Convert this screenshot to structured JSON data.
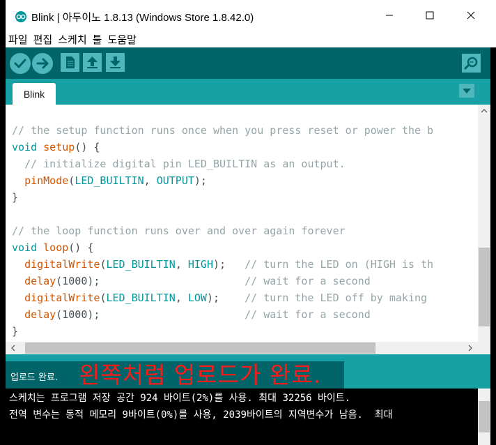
{
  "window": {
    "title": "Blink | 아두이노 1.8.13 (Windows Store 1.8.42.0)"
  },
  "menubar": {
    "items": [
      "파일",
      "편집",
      "스케치",
      "툴",
      "도움말"
    ]
  },
  "toolbar": {
    "buttons": [
      {
        "name": "verify",
        "icon": "check-icon"
      },
      {
        "name": "upload",
        "icon": "arrow-right-icon"
      },
      {
        "name": "new",
        "icon": "document-icon"
      },
      {
        "name": "open",
        "icon": "arrow-up-icon"
      },
      {
        "name": "save",
        "icon": "arrow-down-icon"
      },
      {
        "name": "serial-monitor",
        "icon": "magnifier-icon"
      }
    ]
  },
  "tabs": {
    "active": "Blink"
  },
  "editor": {
    "lines": [
      "// the setup function runs once when you press reset or power the b",
      "void setup() {",
      "  // initialize digital pin LED_BUILTIN as an output.",
      "  pinMode(LED_BUILTIN, OUTPUT);",
      "}",
      "",
      "// the loop function runs over and over again forever",
      "void loop() {",
      "  digitalWrite(LED_BUILTIN, HIGH);   // turn the LED on (HIGH is th",
      "  delay(1000);                       // wait for a second",
      "  digitalWrite(LED_BUILTIN, LOW);    // turn the LED off by making",
      "  delay(1000);                       // wait for a second",
      "}"
    ]
  },
  "status": {
    "message": "업로드 완료.",
    "overlay_annotation": "왼쪽처럼 업로드가 완료."
  },
  "console": {
    "lines": [
      "스케치는 프로그램 저장 공간 924 바이트(2%)를 사용. 최대 32256 바이트.",
      "전역 변수는 동적 메모리 9바이트(0%)를 사용, 2039바이트의 지역변수가 남음.  최대"
    ]
  },
  "colors": {
    "toolbar_bg": "#006468",
    "tabbar_bg": "#17a1a5",
    "button_bg": "#4db7bb",
    "comment": "#95a5a6",
    "keyword": "#00979c",
    "function": "#d35400",
    "overlay": "#ff1a1a"
  }
}
